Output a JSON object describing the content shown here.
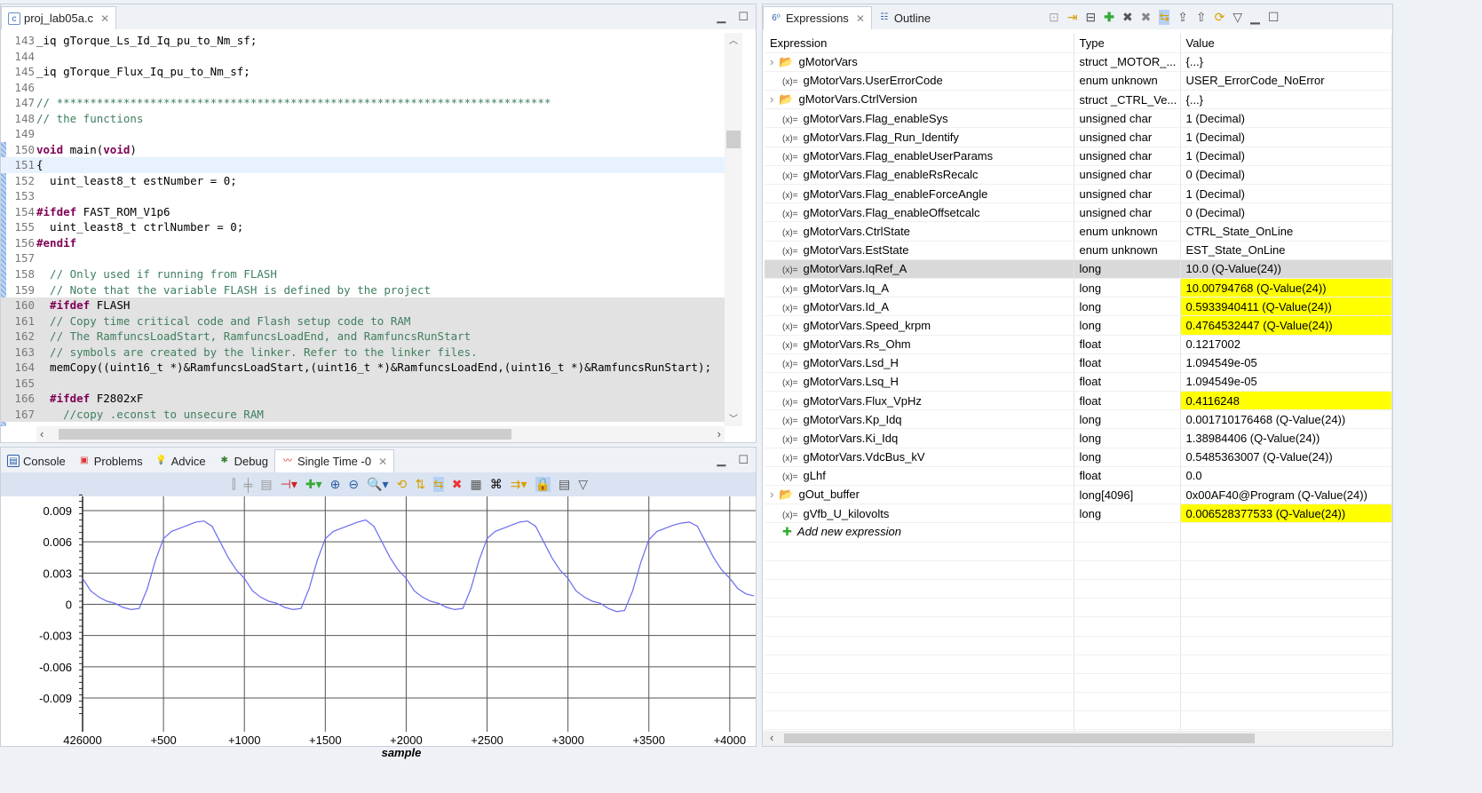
{
  "editor": {
    "tab": "proj_lab05a.c",
    "lines": [
      {
        "n": "143",
        "seg": [
          [
            "",
            "_iq gTorque_Ls_Id_Iq_pu_to_Nm_sf;"
          ]
        ]
      },
      {
        "n": "144",
        "seg": []
      },
      {
        "n": "145",
        "seg": [
          [
            "",
            "_iq gTorque_Flux_Iq_pu_to_Nm_sf;"
          ]
        ]
      },
      {
        "n": "146",
        "seg": []
      },
      {
        "n": "147",
        "seg": [
          [
            "cm",
            "// **************************************************************************"
          ]
        ]
      },
      {
        "n": "148",
        "seg": [
          [
            "cm",
            "// the functions"
          ]
        ]
      },
      {
        "n": "149",
        "seg": []
      },
      {
        "n": "150",
        "seg": [
          [
            "kw",
            "void"
          ],
          [
            "",
            " main("
          ],
          [
            "kw",
            "void"
          ],
          [
            "",
            ")"
          ]
        ]
      },
      {
        "n": "151",
        "seg": [
          [
            "",
            "{"
          ]
        ],
        "hl": true
      },
      {
        "n": "152",
        "seg": [
          [
            "",
            "  uint_least8_t estNumber = 0;"
          ]
        ]
      },
      {
        "n": "153",
        "seg": []
      },
      {
        "n": "154",
        "seg": [
          [
            "pp",
            "#ifdef"
          ],
          [
            "",
            " FAST_ROM_V1p6"
          ]
        ]
      },
      {
        "n": "155",
        "seg": [
          [
            "",
            "  uint_least8_t ctrlNumber = 0;"
          ]
        ]
      },
      {
        "n": "156",
        "seg": [
          [
            "pp",
            "#endif"
          ]
        ]
      },
      {
        "n": "157",
        "seg": []
      },
      {
        "n": "158",
        "seg": [
          [
            "cm",
            "  // Only used if running from FLASH"
          ]
        ]
      },
      {
        "n": "159",
        "seg": [
          [
            "cm",
            "  // Note that the variable FLASH is defined by the project"
          ]
        ]
      },
      {
        "n": "160",
        "seg": [
          [
            "pp",
            "  #ifdef"
          ],
          [
            "",
            " FLASH"
          ]
        ],
        "gray": true
      },
      {
        "n": "161",
        "seg": [
          [
            "cm",
            "  // Copy time critical code and Flash setup code to RAM"
          ]
        ],
        "gray": true
      },
      {
        "n": "162",
        "seg": [
          [
            "cm",
            "  // The RamfuncsLoadStart, RamfuncsLoadEnd, and RamfuncsRunStart"
          ]
        ],
        "gray": true
      },
      {
        "n": "163",
        "seg": [
          [
            "cm",
            "  // symbols are created by the linker. Refer to the linker files."
          ]
        ],
        "gray": true
      },
      {
        "n": "164",
        "seg": [
          [
            "",
            "  memCopy((uint16_t *)&RamfuncsLoadStart,(uint16_t *)&RamfuncsLoadEnd,(uint16_t *)&RamfuncsRunStart);"
          ]
        ],
        "gray": true
      },
      {
        "n": "165",
        "seg": [],
        "gray": true
      },
      {
        "n": "166",
        "seg": [
          [
            "pp",
            "  #ifdef"
          ],
          [
            "",
            " F2802xF"
          ]
        ],
        "gray": true
      },
      {
        "n": "167",
        "seg": [
          [
            "cm",
            "    //copy .econst to unsecure RAM"
          ]
        ],
        "gray": true
      }
    ]
  },
  "bottom": {
    "tabs": [
      "Console",
      "Problems",
      "Advice",
      "Debug",
      "Single Time -0"
    ]
  },
  "right": {
    "tabs": [
      "Expressions",
      "Outline"
    ],
    "columns": [
      "Expression",
      "Type",
      "Value"
    ],
    "add_label": "Add new expression",
    "rows": [
      {
        "e": "gMotorVars",
        "t": "struct _MOTOR_...",
        "v": "{...}",
        "s": true
      },
      {
        "e": "gMotorVars.UserErrorCode",
        "t": "enum unknown",
        "v": "USER_ErrorCode_NoError"
      },
      {
        "e": "gMotorVars.CtrlVersion",
        "t": "struct _CTRL_Ve...",
        "v": "{...}",
        "s": true
      },
      {
        "e": "gMotorVars.Flag_enableSys",
        "t": "unsigned char",
        "v": "1 (Decimal)"
      },
      {
        "e": "gMotorVars.Flag_Run_Identify",
        "t": "unsigned char",
        "v": "1 (Decimal)"
      },
      {
        "e": "gMotorVars.Flag_enableUserParams",
        "t": "unsigned char",
        "v": "1 (Decimal)"
      },
      {
        "e": "gMotorVars.Flag_enableRsRecalc",
        "t": "unsigned char",
        "v": "0 (Decimal)"
      },
      {
        "e": "gMotorVars.Flag_enableForceAngle",
        "t": "unsigned char",
        "v": "1 (Decimal)"
      },
      {
        "e": "gMotorVars.Flag_enableOffsetcalc",
        "t": "unsigned char",
        "v": "0 (Decimal)"
      },
      {
        "e": "gMotorVars.CtrlState",
        "t": "enum unknown",
        "v": "CTRL_State_OnLine"
      },
      {
        "e": "gMotorVars.EstState",
        "t": "enum unknown",
        "v": "EST_State_OnLine"
      },
      {
        "e": "gMotorVars.IqRef_A",
        "t": "long",
        "v": "10.0 (Q-Value(24))",
        "sel": true
      },
      {
        "e": "gMotorVars.Iq_A",
        "t": "long",
        "v": "10.00794768 (Q-Value(24))",
        "y": true
      },
      {
        "e": "gMotorVars.Id_A",
        "t": "long",
        "v": "0.5933940411 (Q-Value(24))",
        "y": true
      },
      {
        "e": "gMotorVars.Speed_krpm",
        "t": "long",
        "v": "0.4764532447 (Q-Value(24))",
        "y": true
      },
      {
        "e": "gMotorVars.Rs_Ohm",
        "t": "float",
        "v": "0.1217002"
      },
      {
        "e": "gMotorVars.Lsd_H",
        "t": "float",
        "v": "1.094549e-05"
      },
      {
        "e": "gMotorVars.Lsq_H",
        "t": "float",
        "v": "1.094549e-05"
      },
      {
        "e": "gMotorVars.Flux_VpHz",
        "t": "float",
        "v": "0.4116248",
        "y": true
      },
      {
        "e": "gMotorVars.Kp_Idq",
        "t": "long",
        "v": "0.001710176468 (Q-Value(24))"
      },
      {
        "e": "gMotorVars.Ki_Idq",
        "t": "long",
        "v": "1.38984406 (Q-Value(24))"
      },
      {
        "e": "gMotorVars.VdcBus_kV",
        "t": "long",
        "v": "0.5485363007 (Q-Value(24))"
      },
      {
        "e": "gLhf",
        "t": "float",
        "v": "0.0"
      },
      {
        "e": "gOut_buffer",
        "t": "long[4096]",
        "v": "0x00AF40@Program (Q-Value(24))",
        "s": true
      },
      {
        "e": "gVfb_U_kilovolts",
        "t": "long",
        "v": "0.006528377533 (Q-Value(24))",
        "y": true
      }
    ]
  },
  "colors": {
    "trace": "#6b6bf0",
    "highlight": "#ffff00"
  },
  "chart_data": {
    "type": "line",
    "xlabel": "sample",
    "ylabel": "",
    "title": "Single Time -0",
    "x_base": "426000",
    "xlim": [
      0,
      4160
    ],
    "ylim": [
      -0.0105,
      0.0105
    ],
    "xticks": [
      0,
      500,
      1000,
      1500,
      2000,
      2500,
      3000,
      3500,
      4000
    ],
    "xtick_labels": [
      "426000",
      "+500",
      "+1000",
      "+1500",
      "+2000",
      "+2500",
      "+3000",
      "+3500",
      "+4000"
    ],
    "yticks": [
      0.009,
      0.006,
      0.003,
      0,
      -0.003,
      -0.006,
      -0.009
    ],
    "ytick_labels": [
      "0.009",
      "0.006",
      "0.003",
      "0",
      "-0.003",
      "-0.006",
      "-0.009"
    ],
    "x_step": 50,
    "values": [
      0.0025,
      0.0013,
      0.0007,
      0.0003,
      0.0001,
      -0.0003,
      -0.0005,
      -0.0004,
      0.0015,
      0.0042,
      0.0063,
      0.007,
      0.0073,
      0.0076,
      0.0079,
      0.008,
      0.0075,
      0.006,
      0.0045,
      0.0033,
      0.0025,
      0.0013,
      0.0007,
      0.0003,
      0.0001,
      -0.0003,
      -0.0005,
      -0.0004,
      0.0015,
      0.0042,
      0.0063,
      0.007,
      0.0073,
      0.0076,
      0.0079,
      0.0081,
      0.0075,
      0.006,
      0.0045,
      0.0033,
      0.0025,
      0.0013,
      0.0007,
      0.0003,
      0.0001,
      -0.0003,
      -0.0005,
      -0.0004,
      0.0015,
      0.0042,
      0.0063,
      0.007,
      0.0073,
      0.0076,
      0.0079,
      0.008,
      0.0075,
      0.006,
      0.0045,
      0.0033,
      0.0025,
      0.0013,
      0.0007,
      0.0003,
      0.0001,
      -0.0004,
      -0.0007,
      -0.0006,
      0.0013,
      0.004,
      0.0062,
      0.007,
      0.0073,
      0.0076,
      0.0078,
      0.0079,
      0.0075,
      0.006,
      0.0045,
      0.0033,
      0.0025,
      0.0015,
      0.001,
      0.0008
    ]
  }
}
